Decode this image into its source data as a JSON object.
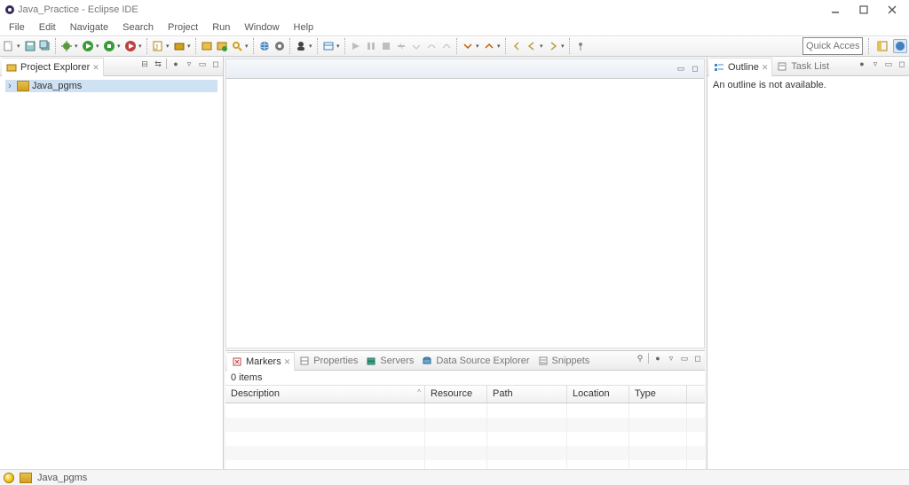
{
  "title": "Java_Practice - Eclipse IDE",
  "menu": {
    "items": [
      "File",
      "Edit",
      "Navigate",
      "Search",
      "Project",
      "Run",
      "Window",
      "Help"
    ]
  },
  "toolbar": {
    "quick_access_placeholder": "Quick Access"
  },
  "left_view": {
    "tab_label": "Project Explorer",
    "tree": {
      "root_label": "Java_pgms"
    }
  },
  "right_view": {
    "tab1_label": "Outline",
    "tab2_label": "Task List",
    "body_text": "An outline is not available."
  },
  "bottom_view": {
    "tabs": [
      "Markers",
      "Properties",
      "Servers",
      "Data Source Explorer",
      "Snippets"
    ],
    "items_count_text": "0 items",
    "columns": [
      "Description",
      "Resource",
      "Path",
      "Location",
      "Type"
    ]
  },
  "statusbar": {
    "project_label": "Java_pgms"
  }
}
